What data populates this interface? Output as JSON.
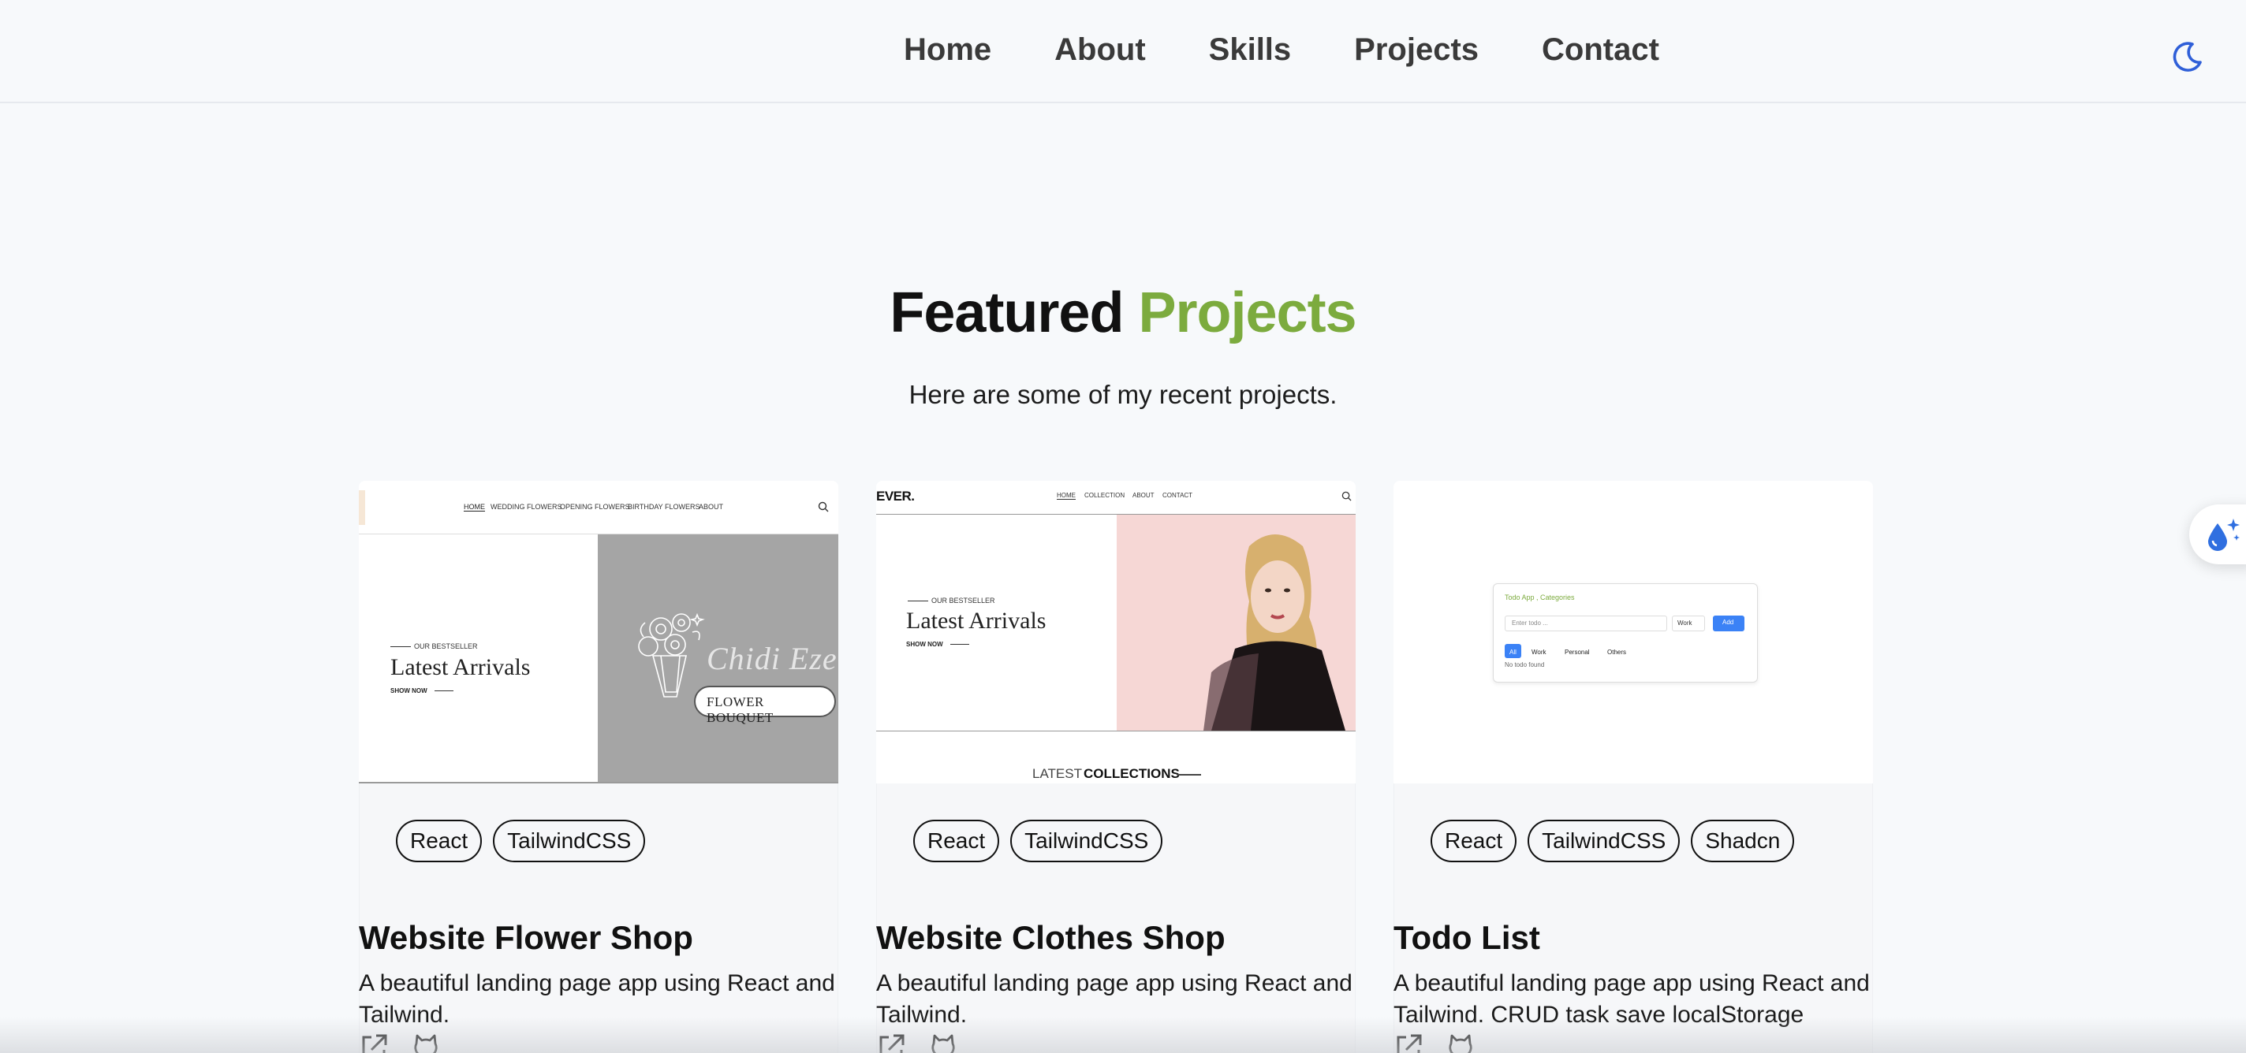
{
  "nav": {
    "links": [
      "Home",
      "About",
      "Skills",
      "Projects",
      "Contact"
    ],
    "theme_icon": "moon-icon"
  },
  "side_button": {
    "icon": "sparkle-drop-icon"
  },
  "section": {
    "title_main": "Featured",
    "title_accent": "Projects",
    "subtitle": "Here are some of my recent projects.",
    "accent_color": "#7cab3e"
  },
  "projects": [
    {
      "title": "Website Flower Shop",
      "description": "A beautiful landing page app using React and Tailwind.",
      "tags": [
        "React",
        "TailwindCSS"
      ],
      "preview": {
        "nav": [
          "HOME",
          "WEDDING FLOWERS",
          "OPENING FLOWERS",
          "BIRTHDAY FLOWERS",
          "ABOUT"
        ],
        "eyebrow": "OUR BESTSELLER",
        "heading": "Latest Arrivals",
        "cta": "SHOW NOW",
        "logo_script": "Chidi Eze",
        "banner": "FLOWER BOUQUET"
      }
    },
    {
      "title": "Website Clothes Shop",
      "description": "A beautiful landing page app using React and Tailwind.",
      "tags": [
        "React",
        "TailwindCSS"
      ],
      "preview": {
        "brand": "EVER.",
        "nav": [
          "HOME",
          "COLLECTION",
          "ABOUT",
          "CONTACT"
        ],
        "eyebrow": "OUR BESTSELLER",
        "heading": "Latest Arrivals",
        "cta": "SHOW NOW",
        "footer_left": "LATEST",
        "footer_right": "COLLECTIONS"
      }
    },
    {
      "title": "Todo List",
      "description": "A beautiful landing page app using React and Tailwind. CRUD task save localStorage",
      "tags": [
        "React",
        "TailwindCSS",
        "Shadcn"
      ],
      "preview": {
        "app_title": "Todo App , Categories",
        "input_placeholder": "Enter todo ...",
        "select_value": "Work",
        "add_label": "Add",
        "filters": [
          "All",
          "Work",
          "Personal",
          "Others"
        ],
        "empty": "No todo found"
      }
    }
  ],
  "link_icons": [
    "external-link-icon",
    "github-icon"
  ]
}
